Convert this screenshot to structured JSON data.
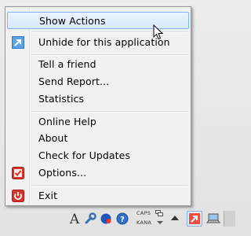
{
  "menu": {
    "items": [
      {
        "label": "Show Actions",
        "highlighted": true,
        "icon": null
      },
      {
        "label": "Unhide for this application",
        "icon": "unhide-arrow-icon"
      },
      {
        "label": "Tell a friend"
      },
      {
        "label": "Send Report..."
      },
      {
        "label": "Statistics"
      },
      {
        "label": "Online Help"
      },
      {
        "label": "About"
      },
      {
        "label": "Check for Updates"
      },
      {
        "label": "Options...",
        "icon": "options-checkbox-icon"
      },
      {
        "label": "Exit",
        "icon": "power-icon"
      }
    ]
  },
  "taskbar": {
    "caps_label": "CAPS",
    "kana_label": "KANA",
    "ime_label": "A",
    "tray_icons": [
      "ime-a-icon",
      "wrench-icon",
      "blue-ball-icon",
      "help-icon",
      "keyboard-icon",
      "up-arrow-icon",
      "app-arrow-icon",
      "laptop-icon"
    ]
  },
  "colors": {
    "highlight_border": "#80b3e8",
    "highlight_fill": "#dbeafb",
    "icon_red": "#d9342b",
    "app_icon_blue": "#3b8fd8"
  }
}
